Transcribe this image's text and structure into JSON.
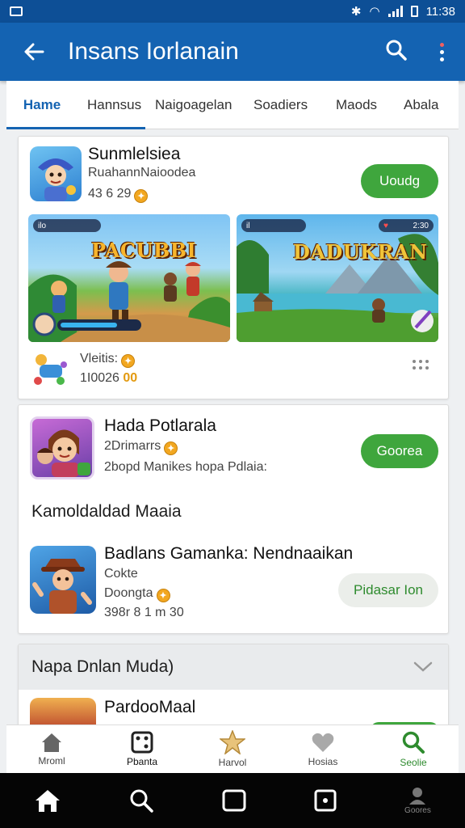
{
  "status_bar": {
    "time": "11:38"
  },
  "app_bar": {
    "title": "Insans Iorlanain",
    "back_icon": "arrow-left-icon",
    "search_icon": "search-icon",
    "menu_icon": "more-vert-icon"
  },
  "tabs": [
    {
      "label": "Hame",
      "active": true
    },
    {
      "label": "Hannsus"
    },
    {
      "label": "Naigoagelan"
    },
    {
      "label": "Soadiers"
    },
    {
      "label": "Maods"
    },
    {
      "label": "Abala"
    }
  ],
  "featured": {
    "name": "Sunmlelsiea",
    "developer": "RuahannNaioodea",
    "rating": "43 6 29",
    "install_label": "Uoudg",
    "screenshots": [
      {
        "logo": "PACUBBI",
        "hud": "ilo"
      },
      {
        "logo": "DADUKRAN",
        "hud": "il",
        "score": "2:30"
      }
    ],
    "meta_label": "Vleitis:",
    "meta_count": "1I0026",
    "meta_badge": "00"
  },
  "second_app": {
    "name": "Hada Potlarala",
    "rating": "2Drimarrs",
    "description": "2bopd Manikes hopa Pdlaia:",
    "install_label": "Goorea"
  },
  "section": {
    "title": "Kamoldaldad Maaia",
    "item": {
      "name": "Badlans Gamanka: Nendnaaikan",
      "line1": "Cokte",
      "line2": "Doongta",
      "line3": "398r 8 1 m 30",
      "button_label": "Pidasar Ion"
    }
  },
  "collapsed_section": {
    "title": "Napa Dnlan Muda)",
    "item_name": "PardooMaal"
  },
  "bottom_nav": [
    {
      "label": "Mroml",
      "icon": "home-icon"
    },
    {
      "label": "Pbanta",
      "icon": "dice-icon"
    },
    {
      "label": "Harvol",
      "icon": "star-icon"
    },
    {
      "label": "Hosias",
      "icon": "heart-icon"
    },
    {
      "label": "Seolie",
      "icon": "search-icon",
      "active": true
    }
  ],
  "system_nav": {
    "extra_label": "Goores"
  },
  "colors": {
    "primary": "#1463b2",
    "status_bar": "#0d4f96",
    "accent_green": "#3fa63d",
    "coin": "#f2a720"
  }
}
